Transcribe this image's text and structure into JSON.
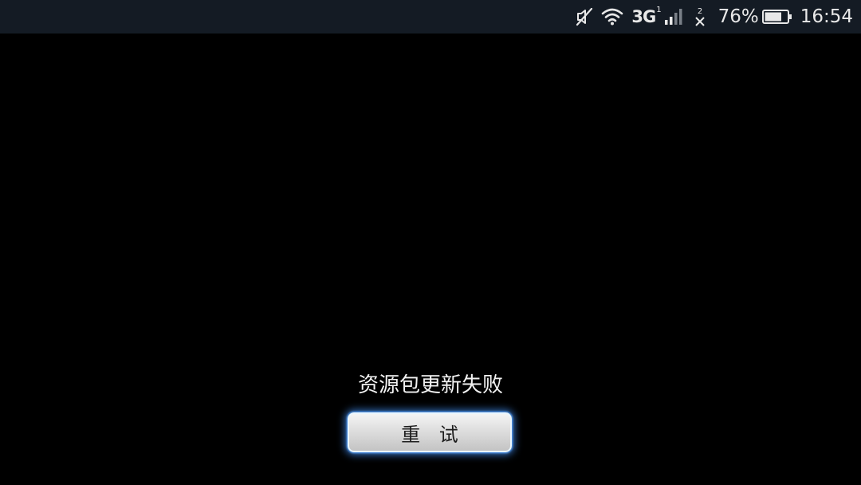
{
  "status_bar": {
    "network_type": "3G",
    "sim1_label": "1",
    "sim2_label": "2",
    "battery_percent": "76%",
    "battery_level": 0.76,
    "time": "16:54",
    "icons": [
      "mute-icon",
      "wifi-icon",
      "signal-icon",
      "no-signal-icon",
      "battery-icon"
    ]
  },
  "main": {
    "message": "资源包更新失败",
    "retry_label": "重 试"
  },
  "colors": {
    "background": "#000000",
    "status_bar": "#141b24",
    "button_glow": "#4696ff"
  }
}
